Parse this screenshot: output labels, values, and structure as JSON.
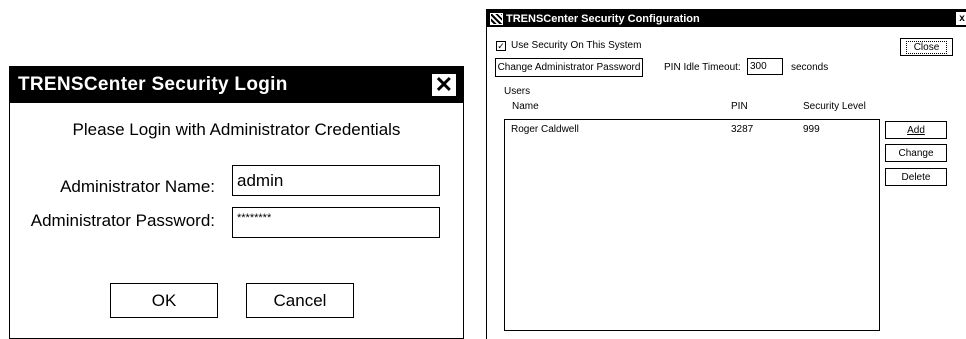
{
  "login_dialog": {
    "title": "TRENSCenter Security Login",
    "close_glyph": "✕",
    "heading": "Please Login with Administrator Credentials",
    "name_label": "Administrator Name:",
    "name_value": "admin",
    "password_label": "Administrator Password:",
    "password_value": "********",
    "ok_label": "OK",
    "cancel_label": "Cancel"
  },
  "config_window": {
    "title": "TRENSCenter Security Configuration",
    "close_glyph": "x",
    "app_icon": "app-icon",
    "use_security_label": "Use Security On This System",
    "use_security_checked": true,
    "check_glyph": "✓",
    "close_button_label": "Close",
    "change_admin_pw_label": "Change Administrator Password",
    "pin_timeout_label": "PIN Idle Timeout:",
    "pin_timeout_value": "300",
    "seconds_label": "seconds",
    "users_group_label": "Users",
    "columns": {
      "name": "Name",
      "pin": "PIN",
      "level": "Security Level"
    },
    "users": [
      {
        "name": "Roger Caldwell",
        "pin": "3287",
        "level": "999"
      }
    ],
    "add_label": "Add",
    "change_label": "Change",
    "delete_label": "Delete"
  }
}
